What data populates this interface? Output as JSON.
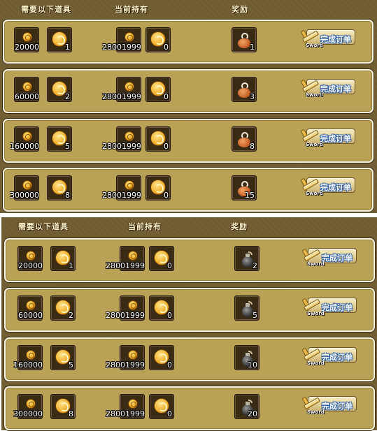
{
  "panels": [
    {
      "headers": {
        "required": "需要以下道具",
        "held": "当前持有",
        "reward": "奖励"
      },
      "reward_icon": "meat-icon",
      "rows": [
        {
          "req_coin": "20000",
          "req_medal": "1",
          "held_coin": "28001999",
          "held_medal": "0",
          "reward_qty": "1",
          "button": "完成订单",
          "button_tag": "Sword"
        },
        {
          "req_coin": "60000",
          "req_medal": "2",
          "held_coin": "28001999",
          "held_medal": "0",
          "reward_qty": "3",
          "button": "完成订单",
          "button_tag": "Sword"
        },
        {
          "req_coin": "160000",
          "req_medal": "5",
          "held_coin": "28001999",
          "held_medal": "0",
          "reward_qty": "8",
          "button": "完成订单",
          "button_tag": "Sword"
        },
        {
          "req_coin": "300000",
          "req_medal": "8",
          "held_coin": "28001999",
          "held_medal": "0",
          "reward_qty": "15",
          "button": "完成订单",
          "button_tag": "Sword"
        }
      ]
    },
    {
      "headers": {
        "required": "需要以下道具",
        "held": "当前持有",
        "reward": "奖励"
      },
      "reward_icon": "bomb-icon",
      "rows": [
        {
          "req_coin": "20000",
          "req_medal": "1",
          "held_coin": "28001999",
          "held_medal": "0",
          "reward_qty": "2",
          "button": "完成订单",
          "button_tag": "Sword"
        },
        {
          "req_coin": "60000",
          "req_medal": "2",
          "held_coin": "28001999",
          "held_medal": "0",
          "reward_qty": "5",
          "button": "完成订单",
          "button_tag": "Sword"
        },
        {
          "req_coin": "160000",
          "req_medal": "5",
          "held_coin": "28001999",
          "held_medal": "0",
          "reward_qty": "10",
          "button": "完成订单",
          "button_tag": "Sword"
        },
        {
          "req_coin": "300000",
          "req_medal": "8",
          "held_coin": "28001999",
          "held_medal": "0",
          "reward_qty": "20",
          "button": "完成订单",
          "button_tag": "Sword"
        }
      ]
    }
  ],
  "colors": {
    "panel_bg": "#735f34",
    "row_bg": "#b9a155",
    "button_text_outline": "#2e5fa8"
  }
}
